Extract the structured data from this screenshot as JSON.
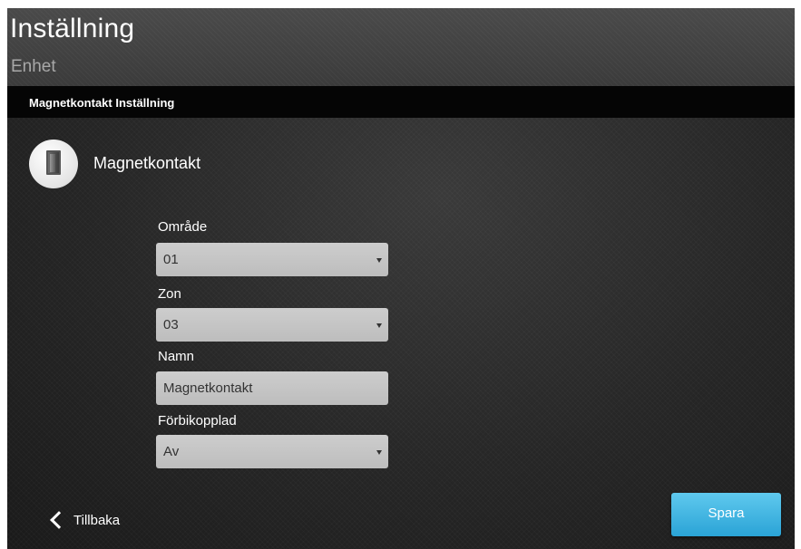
{
  "header": {
    "title": "Inställning",
    "subtitle": "Enhet"
  },
  "section": {
    "title": "Magnetkontakt Inställning"
  },
  "device": {
    "name": "Magnetkontakt",
    "icon": "door-sensor-icon"
  },
  "form": {
    "area": {
      "label": "Område",
      "value": "01"
    },
    "zone": {
      "label": "Zon",
      "value": "03"
    },
    "name": {
      "label": "Namn",
      "value": "Magnetkontakt"
    },
    "bypass": {
      "label": "Förbikopplad",
      "value": "Av"
    }
  },
  "footer": {
    "back_label": "Tillbaka",
    "save_label": "Spara"
  },
  "colors": {
    "accent": "#2aa3d6",
    "field": "#c4c4c4",
    "section_bar": "#050505"
  }
}
